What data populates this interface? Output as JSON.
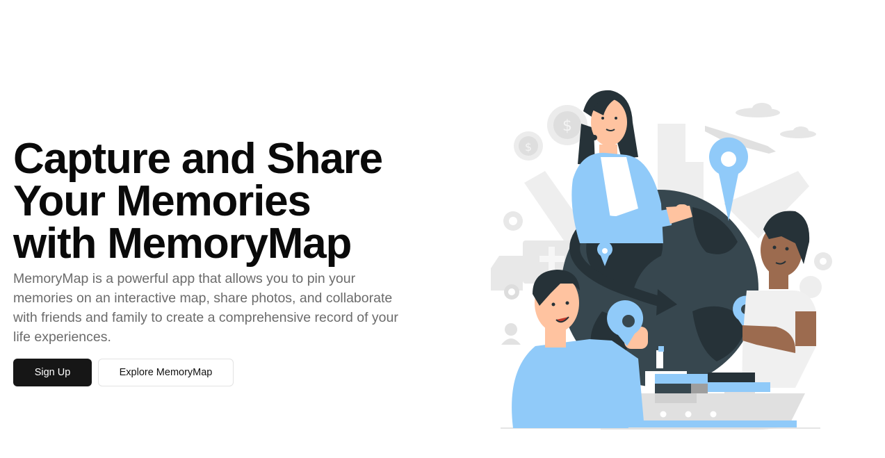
{
  "hero": {
    "headline": "Capture and Share Your Memories with MemoryMap",
    "description": "MemoryMap is a powerful app that allows you to pin your memories on an interactive map, share photos, and collaborate with friends and family to create a comprehensive record of your life experiences.",
    "primary_button": "Sign Up",
    "secondary_button": "Explore MemoryMap"
  },
  "illustration": {
    "subject": "people-around-globe-illustration",
    "icons": [
      "dollar-coin-icon",
      "airplane-icon",
      "map-pin-icon",
      "gear-icon",
      "truck-icon",
      "cargo-ship-icon",
      "user-icon",
      "cloud-icon"
    ],
    "colors": {
      "globe": "#37474f",
      "accent_blue": "#90caf9",
      "background_shapes": "#ebebeb"
    }
  }
}
